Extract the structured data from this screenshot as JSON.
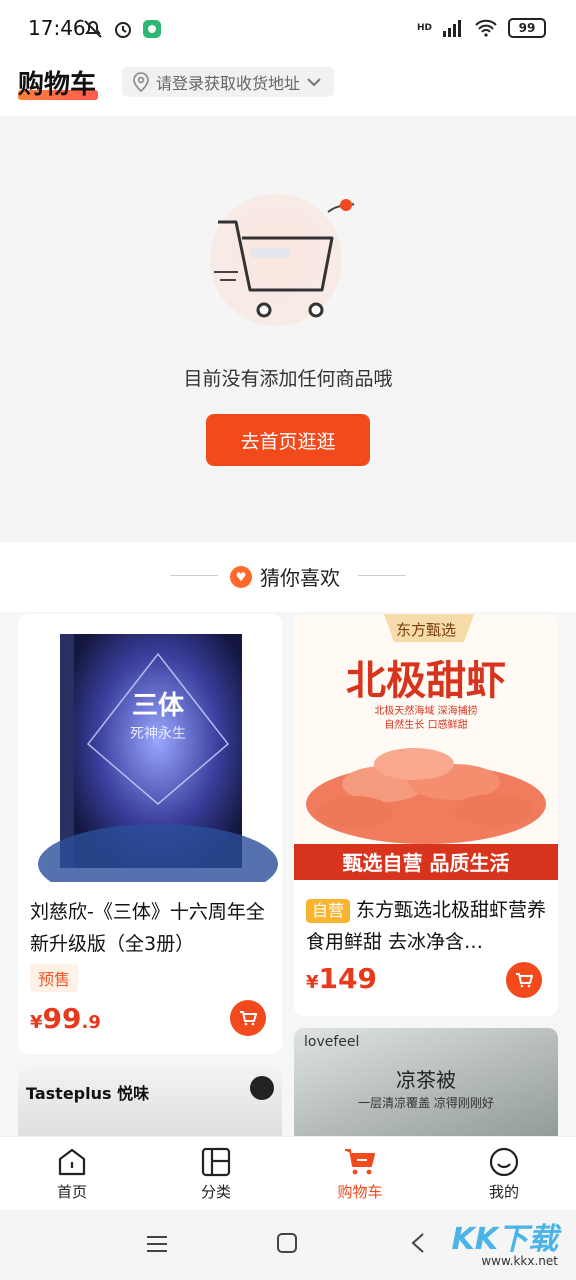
{
  "status": {
    "time": "17:46",
    "network": "HD",
    "battery": "99"
  },
  "header": {
    "title": "购物车",
    "address_placeholder": "请登录获取收货地址"
  },
  "empty": {
    "message": "目前没有添加任何商品哦",
    "button": "去首页逛逛"
  },
  "recommend": {
    "title": "猜你喜欢",
    "products": [
      {
        "title": "刘慈欣-《三体》十六周年全新升级版（全3册）",
        "tag": "预售",
        "price_symbol": "¥",
        "price_int": "99",
        "price_dec": ".9",
        "cover_title": "三体",
        "cover_subtitle": "死神永生"
      },
      {
        "title": "东方甄选北极甜虾营养食用鲜甜 去冰净含…",
        "tag": "自营",
        "price_symbol": "¥",
        "price_int": "149",
        "banner_brand": "东方甄选",
        "banner_title": "北极甜虾",
        "banner_sub1": "北极天然海域 深海捕捞",
        "banner_sub2": "自然生长 口感鲜甜",
        "banner_footer": "甄选自营 品质生活"
      },
      {
        "brand": "Tasteplus 悦味"
      },
      {
        "brand": "lovefeel",
        "title": "凉茶被",
        "subtitle": "一层清凉覆盖 凉得刚刚好"
      }
    ]
  },
  "tabs": [
    {
      "label": "首页",
      "icon": "home-icon"
    },
    {
      "label": "分类",
      "icon": "category-icon"
    },
    {
      "label": "购物车",
      "icon": "cart-icon",
      "active": true
    },
    {
      "label": "我的",
      "icon": "profile-icon"
    }
  ],
  "watermark": {
    "main": "KK下载",
    "sub": "www.kkx.net"
  },
  "colors": {
    "accent": "#f24a1d",
    "price": "#e8391c",
    "self_tag": "#f9b532"
  }
}
